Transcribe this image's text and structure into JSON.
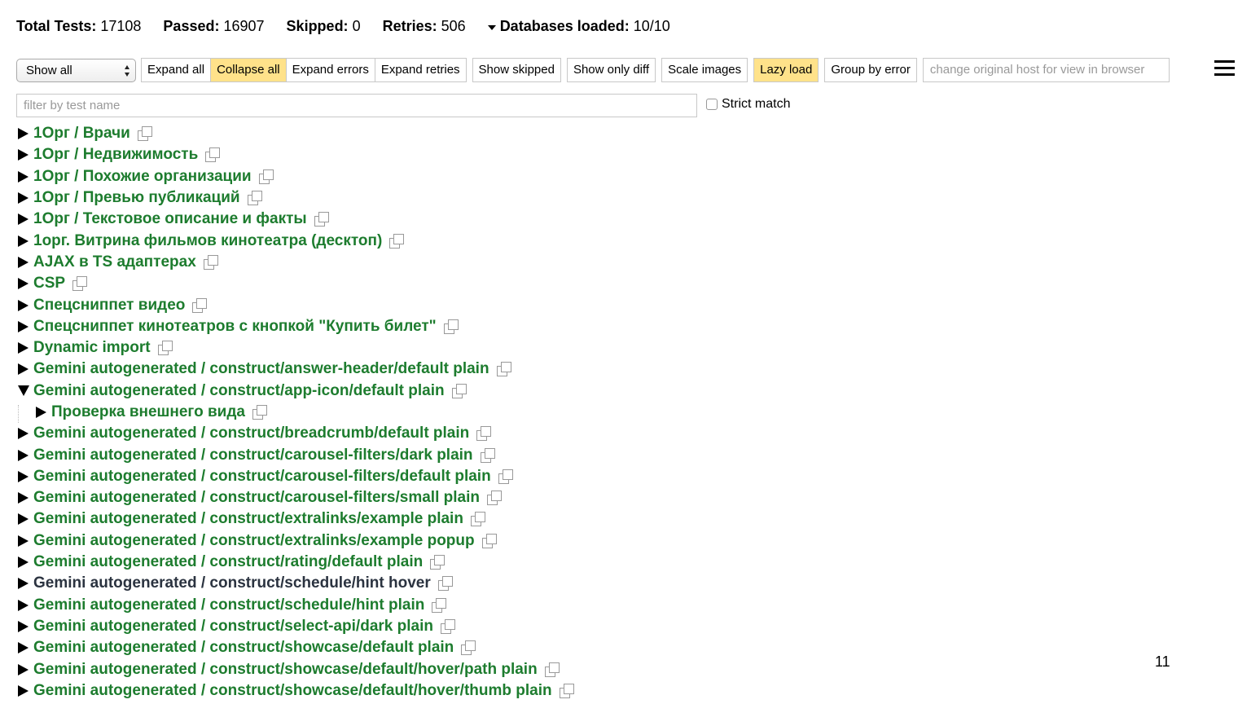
{
  "summary": {
    "total_label": "Total Tests:",
    "total_value": "17108",
    "passed_label": "Passed:",
    "passed_value": "16907",
    "skipped_label": "Skipped:",
    "skipped_value": "0",
    "retries_label": "Retries:",
    "retries_value": "506",
    "databases_label": "Databases loaded:",
    "databases_value": "10/10"
  },
  "toolbar": {
    "view_select": "Show all",
    "expand_all": "Expand all",
    "collapse_all": "Collapse all",
    "expand_errors": "Expand errors",
    "expand_retries": "Expand retries",
    "show_skipped": "Show skipped",
    "show_only_diff": "Show only diff",
    "scale_images": "Scale images",
    "lazy_load": "Lazy load",
    "group_by_error": "Group by error",
    "host_placeholder": "change original host for view in browser",
    "active_color": "#ffe28a"
  },
  "filter": {
    "placeholder": "filter by test name",
    "strict_label": "Strict match"
  },
  "tree": [
    {
      "label": "1Орг / Врачи"
    },
    {
      "label": "1Орг / Недвижимость"
    },
    {
      "label": "1Орг / Похожие организации"
    },
    {
      "label": "1Орг / Превью публикаций"
    },
    {
      "label": "1Орг / Текстовое описание и факты"
    },
    {
      "label": "1орг. Витрина фильмов кинотеатра (десктоп)"
    },
    {
      "label": "AJAX в TS адаптерах"
    },
    {
      "label": "CSP"
    },
    {
      "label": "Спецсниппет видео"
    },
    {
      "label": "Спецсниппет кинотеатров с кнопкой \"Купить билет\""
    },
    {
      "label": "Dynamic import"
    },
    {
      "label": "Gemini autogenerated / construct/answer-header/default plain"
    },
    {
      "label": "Gemini autogenerated / construct/app-icon/default plain"
    },
    {
      "label": "Проверка внешнего вида"
    },
    {
      "label": "Gemini autogenerated / construct/breadcrumb/default plain"
    },
    {
      "label": "Gemini autogenerated / construct/carousel-filters/dark plain"
    },
    {
      "label": "Gemini autogenerated / construct/carousel-filters/default plain"
    },
    {
      "label": "Gemini autogenerated / construct/carousel-filters/small plain"
    },
    {
      "label": "Gemini autogenerated / construct/extralinks/example plain"
    },
    {
      "label": "Gemini autogenerated / construct/extralinks/example popup"
    },
    {
      "label": "Gemini autogenerated / construct/rating/default plain"
    },
    {
      "label": "Gemini autogenerated / construct/schedule/hint hover"
    },
    {
      "label": "Gemini autogenerated / construct/schedule/hint plain"
    },
    {
      "label": "Gemini autogenerated / construct/select-api/dark plain"
    },
    {
      "label": "Gemini autogenerated / construct/showcase/default plain"
    },
    {
      "label": "Gemini autogenerated / construct/showcase/default/hover/path plain"
    },
    {
      "label": "Gemini autogenerated / construct/showcase/default/hover/thumb plain"
    }
  ],
  "colors": {
    "success": "#1d7c2e",
    "neutral": "#2b3340"
  },
  "page_number": "11"
}
